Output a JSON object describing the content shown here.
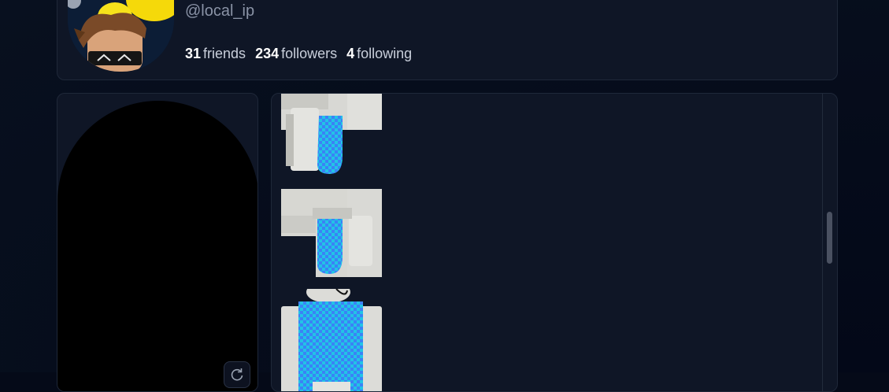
{
  "profile": {
    "handle": "@local_ip",
    "stats": [
      {
        "value": "31",
        "label": "friends"
      },
      {
        "value": "234",
        "label": "followers"
      },
      {
        "value": "4",
        "label": "following"
      }
    ]
  },
  "colors": {
    "background": "#050a18",
    "card": "#0f1626",
    "card_border": "#1f2839",
    "checker_a": "#3b82f6",
    "checker_b": "#22d3ee"
  },
  "viewer": {
    "rotate_icon": "rotate-icon"
  },
  "inventory": {
    "items": [
      {
        "icon": "pants-item-icon"
      },
      {
        "icon": "pants-item-icon"
      },
      {
        "icon": "shirt-item-icon"
      }
    ]
  }
}
